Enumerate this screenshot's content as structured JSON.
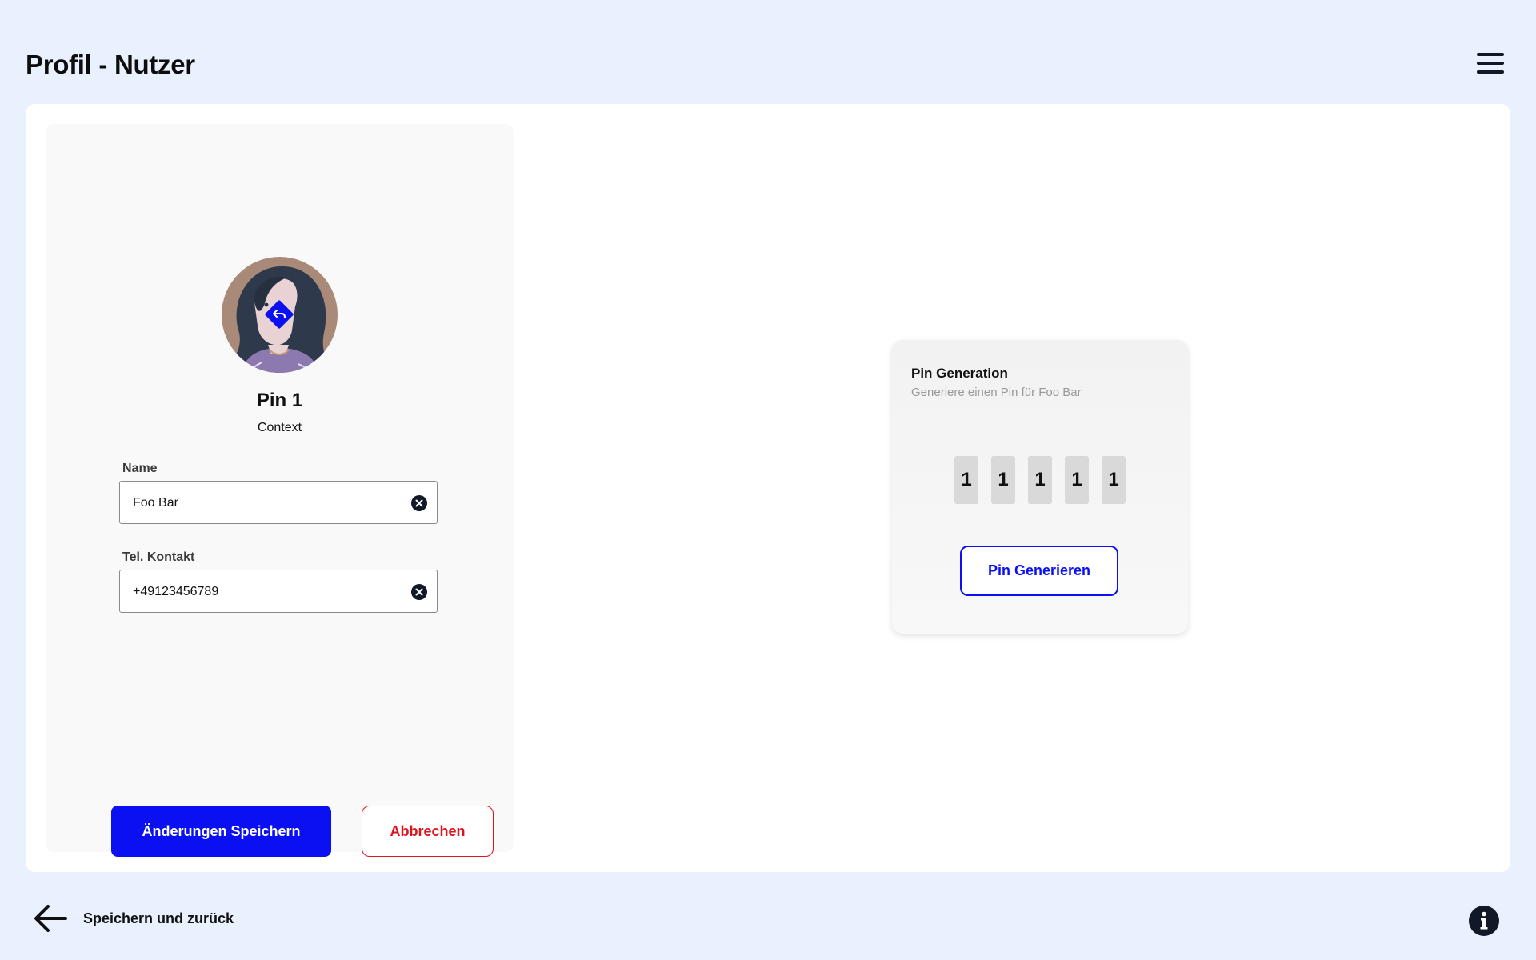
{
  "header": {
    "title": "Profil - Nutzer",
    "menu_icon": "hamburger-menu-icon"
  },
  "profile": {
    "avatar_action_icon": "swap-arrow-icon",
    "title": "Pin 1",
    "context": "Context",
    "fields": [
      {
        "label": "Name",
        "value": "Foo Bar"
      },
      {
        "label": "Tel. Kontakt",
        "value": "+49123456789"
      }
    ],
    "save_label": "Änderungen Speichern",
    "cancel_label": "Abbrechen"
  },
  "pin": {
    "title": "Pin Generation",
    "subtitle": "Generiere einen Pin für Foo Bar",
    "digits": [
      "1",
      "1",
      "1",
      "1",
      "1"
    ],
    "generate_label": "Pin Generieren"
  },
  "footer": {
    "back_label": "Speichern und zurück",
    "back_icon": "arrow-left-icon",
    "info_icon": "info-icon"
  },
  "colors": {
    "background": "#e9f1fe",
    "primary": "#0a10f2",
    "danger": "#e0121b",
    "dark": "#111827"
  }
}
